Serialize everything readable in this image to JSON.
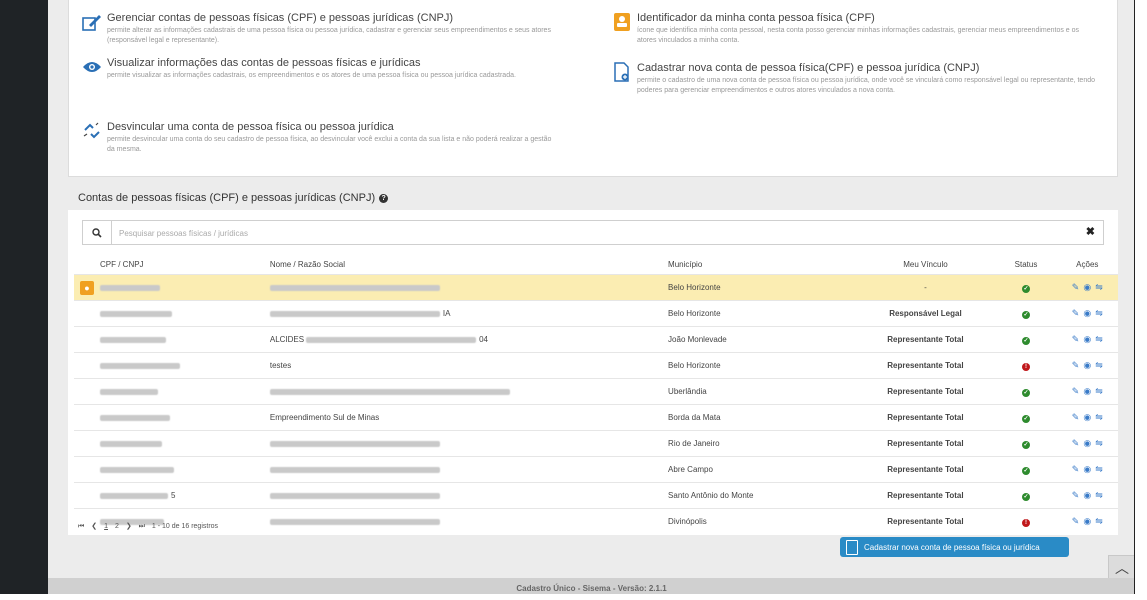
{
  "colors": {
    "accent": "#2a8bc6",
    "highlight": "#fbedb2",
    "ok": "#2e8b2e",
    "error": "#c0181b",
    "badge": "#f0a020"
  },
  "info": {
    "manage": {
      "icon": "edit-icon",
      "title": "Gerenciar contas de pessoas físicas (CPF) e pessoas jurídicas (CNPJ)",
      "desc": "permite alterar as informações cadastrais de uma pessoa física ou pessoa jurídica, cadastrar e gerenciar seus empreendimentos e seus atores (responsável legal e representante)."
    },
    "view": {
      "icon": "eye-icon",
      "title": "Visualizar informações das contas de pessoas físicas e jurídicas",
      "desc": "permite visualizar as informações cadastrais, os empreendimentos e os atores de uma pessoa física ou pessoa jurídica cadastrada."
    },
    "unlink": {
      "icon": "unlink-icon",
      "title": "Desvincular uma conta de pessoa física ou pessoa jurídica",
      "desc": "permite desvincular uma conta do seu cadastro de pessoa física, ao desvincular você exclui a conta da sua lista e não poderá realizar a gestão da mesma."
    },
    "identifier": {
      "icon": "user-badge-icon",
      "title": "Identificador da minha conta pessoa física (CPF)",
      "desc": "ícone que identifica minha conta pessoal, nesta conta posso gerenciar minhas informações cadastrais, gerenciar meus empreendimentos e os atores vinculados a minha conta."
    },
    "create": {
      "icon": "new-document-icon",
      "title": "Cadastrar nova conta de pessoa física(CPF) e pessoa jurídica (CNPJ)",
      "desc": "permite o cadastro de uma nova conta de pessoa física ou pessoa jurídica, onde você se vinculará como responsável legal ou representante, tendo poderes para gerenciar empreendimentos e outros atores vinculados a nova conta."
    }
  },
  "section_title": "Contas de pessoas físicas (CPF) e pessoas jurídicas (CNPJ)",
  "search": {
    "placeholder": "Pesquisar pessoas físicas / jurídicas"
  },
  "table": {
    "headers": {
      "cpf": "CPF / CNPJ",
      "nome": "Nome / Razão Social",
      "municipio": "Município",
      "vinculo": "Meu Vínculo",
      "status": "Status",
      "acoes": "Ações"
    },
    "rows": [
      {
        "cpf_suffix": "",
        "nome_prefix": "",
        "nome_suffix": "",
        "municipio": "Belo Horizonte",
        "vinculo": "-",
        "status": "ok"
      },
      {
        "cpf_suffix": "",
        "nome_prefix": "",
        "nome_suffix": "IA",
        "municipio": "Belo Horizonte",
        "vinculo": "Responsável Legal",
        "status": "ok"
      },
      {
        "cpf_suffix": "",
        "nome_prefix": "ALCIDES",
        "nome_suffix": "04",
        "municipio": "João Monlevade",
        "vinculo": "Representante Total",
        "status": "ok"
      },
      {
        "cpf_suffix": "",
        "nome_prefix": "testes",
        "nome_suffix": "",
        "municipio": "Belo Horizonte",
        "vinculo": "Representante Total",
        "status": "err"
      },
      {
        "cpf_suffix": "",
        "nome_prefix": "",
        "nome_suffix": "",
        "municipio": "Uberlândia",
        "vinculo": "Representante Total",
        "status": "ok"
      },
      {
        "cpf_suffix": "",
        "nome_prefix": "Empreendimento Sul de Minas",
        "nome_suffix": "",
        "municipio": "Borda da Mata",
        "vinculo": "Representante Total",
        "status": "ok"
      },
      {
        "cpf_suffix": "",
        "nome_prefix": "",
        "nome_suffix": "",
        "municipio": "Rio de Janeiro",
        "vinculo": "Representante Total",
        "status": "ok"
      },
      {
        "cpf_suffix": "",
        "nome_prefix": "",
        "nome_suffix": "",
        "municipio": "Abre Campo",
        "vinculo": "Representante Total",
        "status": "ok"
      },
      {
        "cpf_suffix": "5",
        "nome_prefix": "",
        "nome_suffix": "",
        "municipio": "Santo Antônio do Monte",
        "vinculo": "Representante Total",
        "status": "ok"
      },
      {
        "cpf_suffix": "",
        "nome_prefix": "",
        "nome_suffix": "",
        "municipio": "Divinópolis",
        "vinculo": "Representante Total",
        "status": "err"
      }
    ]
  },
  "pager": {
    "page1": "1",
    "page2": "2",
    "summary": "1 - 10 de 16 registros"
  },
  "new_button": "Cadastrar nova conta de pessoa física ou jurídica",
  "footer": "Cadastro Único - Sisema - Versão: 2.1.1"
}
